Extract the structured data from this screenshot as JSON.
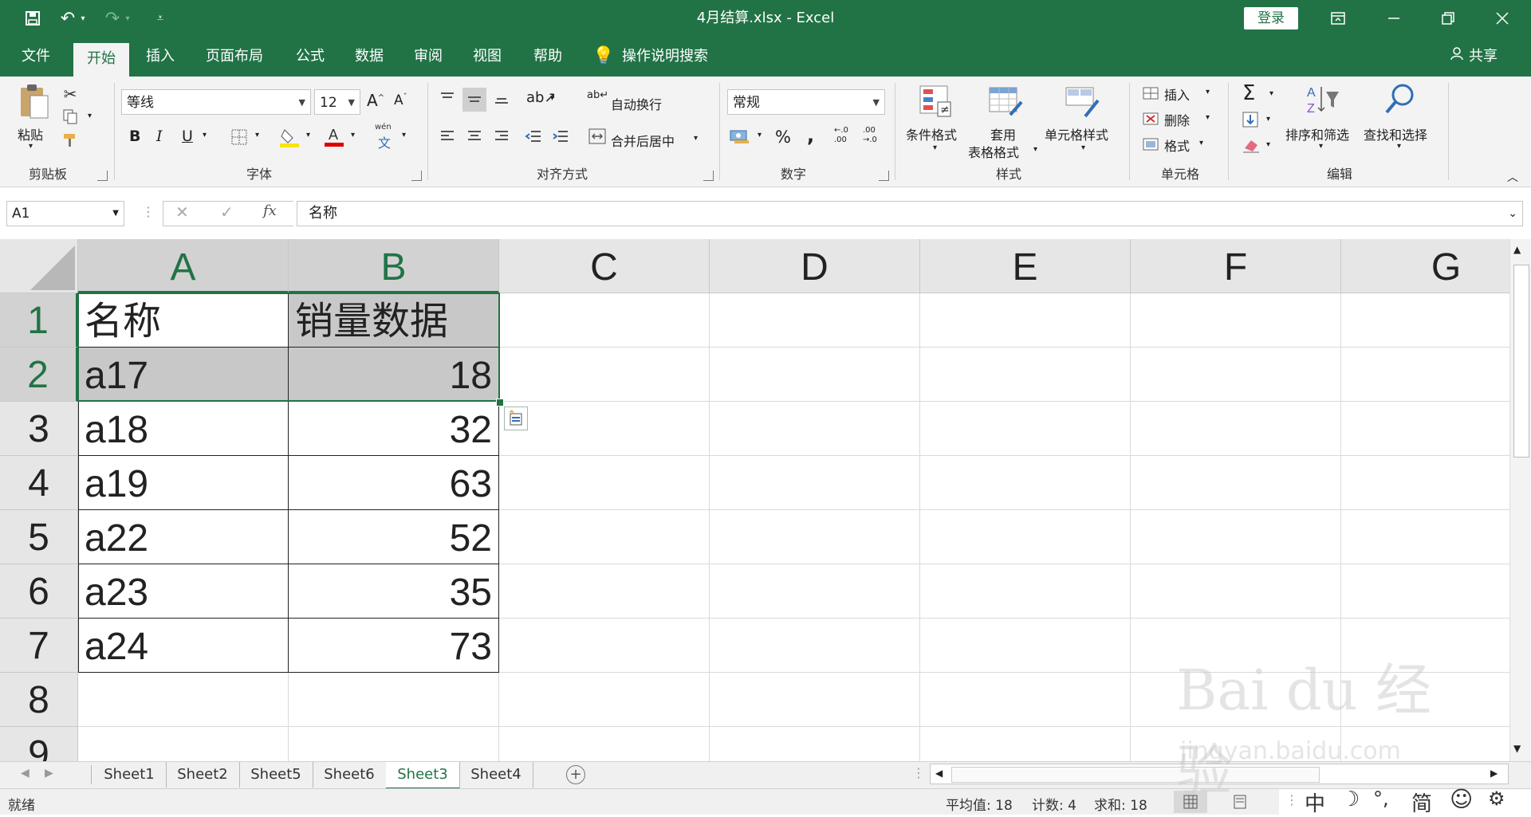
{
  "window": {
    "title": "4月结算.xlsx  -  Excel",
    "login_label": "登录",
    "share_label": "共享"
  },
  "ribbon_tabs": [
    "文件",
    "开始",
    "插入",
    "页面布局",
    "公式",
    "数据",
    "审阅",
    "视图",
    "帮助",
    "操作说明搜索"
  ],
  "ribbon": {
    "clipboard": {
      "paste_label": "粘贴",
      "group_label": "剪贴板"
    },
    "font": {
      "font_name": "等线",
      "font_size": "12",
      "group_label": "字体",
      "bold": "B",
      "italic": "I",
      "underline": "U",
      "phonetic": "wén"
    },
    "alignment": {
      "wrap_label": "自动换行",
      "merge_label": "合并后居中",
      "group_label": "对齐方式"
    },
    "number": {
      "format": "常规",
      "percent": "%",
      "comma": ",",
      "group_label": "数字"
    },
    "styles": {
      "conditional": "条件格式",
      "table_fmt_1": "套用",
      "table_fmt_2": "表格格式",
      "cell_styles": "单元格样式",
      "group_label": "样式"
    },
    "cells": {
      "insert": "插入",
      "delete": "删除",
      "format": "格式",
      "group_label": "单元格"
    },
    "editing": {
      "sort_filter": "排序和筛选",
      "find_select": "查找和选择",
      "group_label": "编辑"
    }
  },
  "formula_bar": {
    "name_box": "A1",
    "fx": "fx",
    "content": "名称"
  },
  "columns": [
    "A",
    "B",
    "C",
    "D",
    "E",
    "F",
    "G"
  ],
  "rows": [
    "1",
    "2",
    "3",
    "4",
    "5",
    "6",
    "7",
    "8",
    "9"
  ],
  "cells": [
    [
      "名称",
      "销量数据"
    ],
    [
      "a17",
      "18"
    ],
    [
      "a18",
      "32"
    ],
    [
      "a19",
      "63"
    ],
    [
      "a22",
      "52"
    ],
    [
      "a23",
      "35"
    ],
    [
      "a24",
      "73"
    ]
  ],
  "sheets": [
    "Sheet1",
    "Sheet2",
    "Sheet5",
    "Sheet6",
    "Sheet3",
    "Sheet4"
  ],
  "active_sheet": "Sheet3",
  "status": {
    "ready": "就绪",
    "average": "平均值: 18",
    "count": "计数: 4",
    "sum": "求和: 18"
  },
  "ime": {
    "mode": "中",
    "moon": "☽",
    "punct": "°,",
    "simplified": "简",
    "emoji": "☺",
    "settings": "⚙"
  },
  "watermark": {
    "logo": "Bai du 经验",
    "url": "jingyan.baidu.com"
  },
  "colors": {
    "brand": "#217346",
    "header_bg": "#e6e6e6",
    "selection": "#c8c8c8"
  }
}
